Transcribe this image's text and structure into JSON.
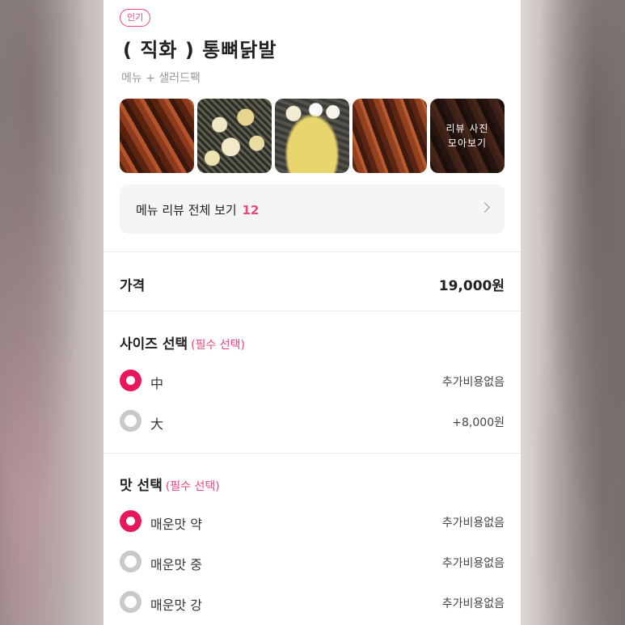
{
  "badge": "인기",
  "title": "( 직화 ) 통뼈닭발",
  "subtitle": "메뉴 + 샐러드팩",
  "thumbnails": {
    "more_label": "리뷰 사진\n모아보기"
  },
  "review_button": {
    "label": "메뉴 리뷰 전체 보기",
    "count": "12"
  },
  "price": {
    "label": "가격",
    "value": "19,000원"
  },
  "size_section": {
    "title": "사이즈 선택",
    "required": "(필수 선택)",
    "options": [
      {
        "name": "中",
        "extra": "추가비용없음",
        "selected": true
      },
      {
        "name": "大",
        "extra": "+8,000원",
        "selected": false
      }
    ]
  },
  "taste_section": {
    "title": "맛 선택",
    "required": "(필수 선택)",
    "options": [
      {
        "name": "매운맛 약",
        "extra": "추가비용없음",
        "selected": true
      },
      {
        "name": "매운맛 중",
        "extra": "추가비용없음",
        "selected": false
      },
      {
        "name": "매운맛 강",
        "extra": "추가비용없음",
        "selected": false
      }
    ]
  },
  "colors": {
    "accent": "#e8175d",
    "accent_text": "#e8477a"
  }
}
